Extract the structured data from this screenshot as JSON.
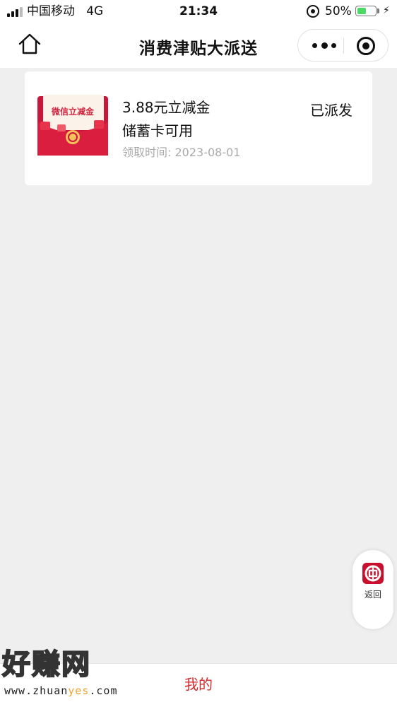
{
  "status_bar": {
    "carrier": "中国移动",
    "network": "4G",
    "time": "21:34",
    "battery_percent": "50%",
    "battery_level": 0.5
  },
  "nav": {
    "title": "消费津贴大派送"
  },
  "coupon": {
    "image_text": "微信立减金",
    "title": "3.88元立减金",
    "subtitle": "储蓄卡可用",
    "date": "领取时间: 2023-08-01",
    "status": "已派发"
  },
  "float_button": {
    "label": "返回"
  },
  "tabbar": {
    "mine_label": "我的",
    "active_color": "#d22b2b"
  },
  "watermark": {
    "brand": "好赚网",
    "url_start": "www.zhuan",
    "url_highlight": "yes",
    "url_end": ".com"
  }
}
